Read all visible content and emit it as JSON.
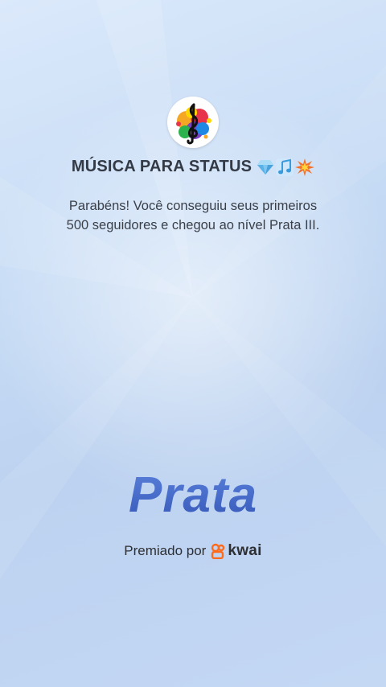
{
  "profile": {
    "name": "MÚSICA PARA STATUS",
    "avatar_icon": "treble-clef-icon",
    "title_emojis": [
      "gem-icon",
      "music-notes-icon",
      "collision-icon"
    ]
  },
  "congrats": {
    "line1": "Parabéns! Você conseguiu seus primeiros",
    "line2": "500 seguidores e chegou ao nível Prata III."
  },
  "level": {
    "name": "Prata",
    "color": "#3d63c4"
  },
  "award": {
    "label": "Premiado por",
    "brand": "kwai",
    "brand_icon": "kwai-logo-icon",
    "brand_color": "#ff6a1a"
  },
  "colors": {
    "background": "#c7dcf5",
    "text": "#333a45"
  }
}
